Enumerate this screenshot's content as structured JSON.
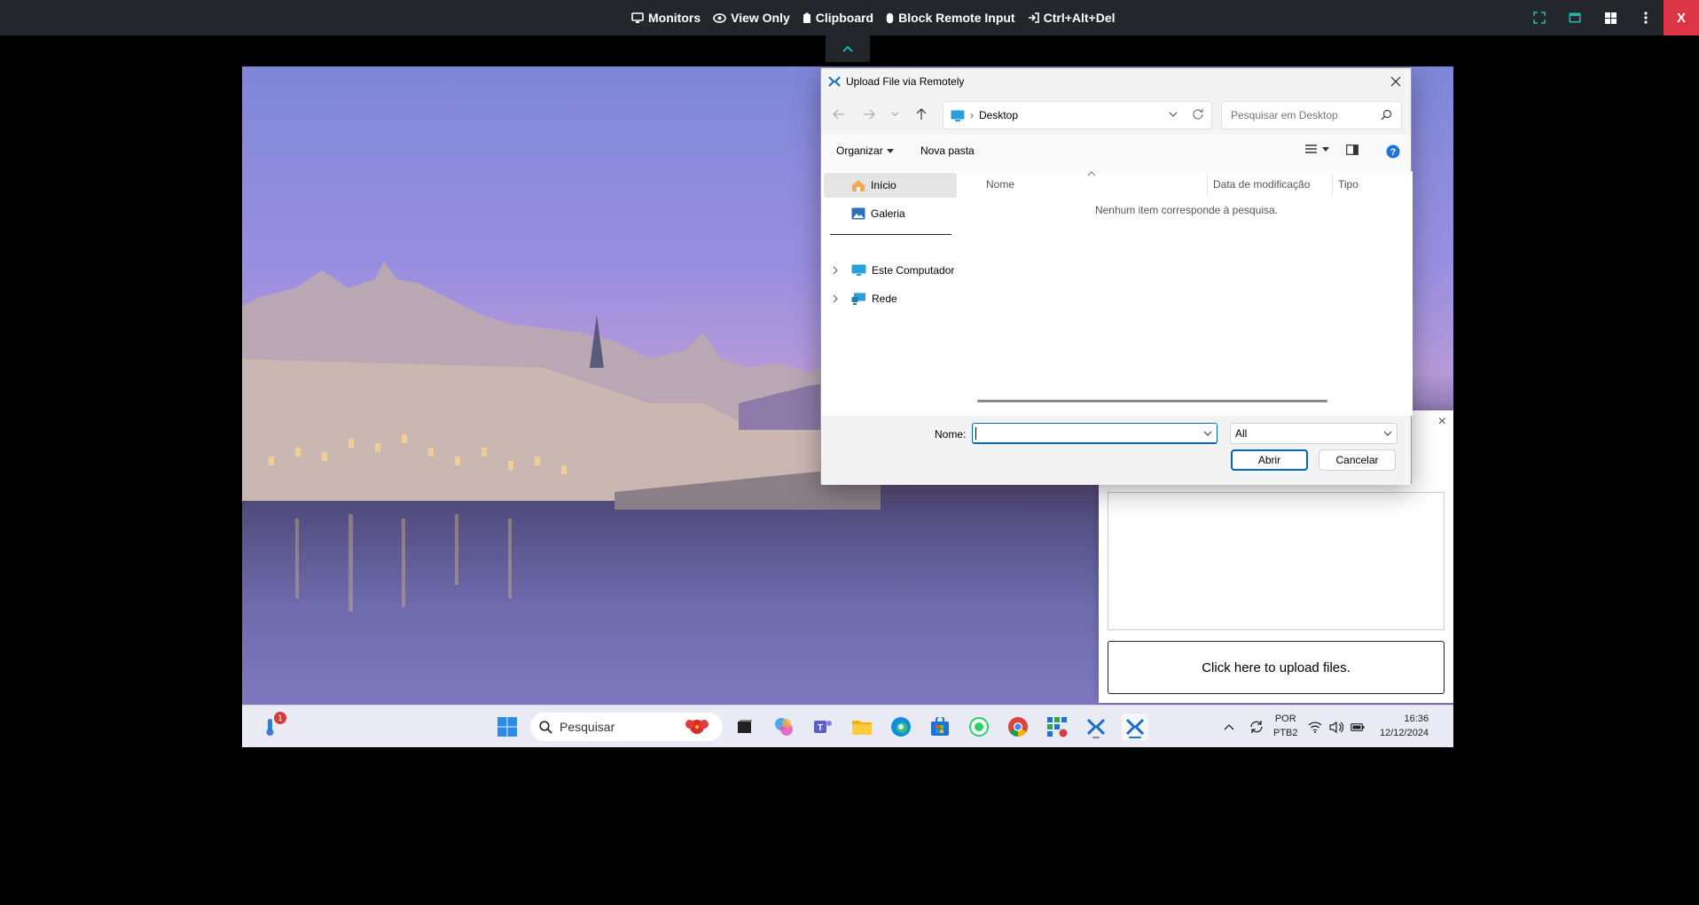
{
  "toolbar": {
    "monitors": "Monitors",
    "view_only": "View Only",
    "clipboard": "Clipboard",
    "block_input": "Block Remote Input",
    "ctrl_alt_del": "Ctrl+Alt+Del",
    "close": "X"
  },
  "dialog": {
    "title": "Upload File via Remotely",
    "address": {
      "crumb": "Desktop"
    },
    "search_placeholder": "Pesquisar em Desktop",
    "organize": "Organizar",
    "new_folder": "Nova pasta",
    "sidebar": {
      "home": "Início",
      "gallery": "Galeria",
      "this_pc": "Este Computador",
      "network": "Rede"
    },
    "columns": {
      "name": "Nome",
      "modified": "Data de modificação",
      "type": "Tipo"
    },
    "empty_message": "Nenhum item corresponde à pesquisa.",
    "file_name_label": "Nome:",
    "file_name_value": "",
    "file_type": "All",
    "open_button": "Abrir",
    "cancel_button": "Cancelar"
  },
  "upload_panel": {
    "upload_button": "Click here to upload files.",
    "close": "×"
  },
  "taskbar": {
    "search_label": "Pesquisar",
    "weather_badge": "1",
    "lang_line1": "POR",
    "lang_line2": "PTB2",
    "time": "16:36",
    "date": "12/12/2024"
  },
  "colors": {
    "toolbar_bg": "#23272b",
    "accent": "#0067c0",
    "close_red": "#dc3545"
  }
}
